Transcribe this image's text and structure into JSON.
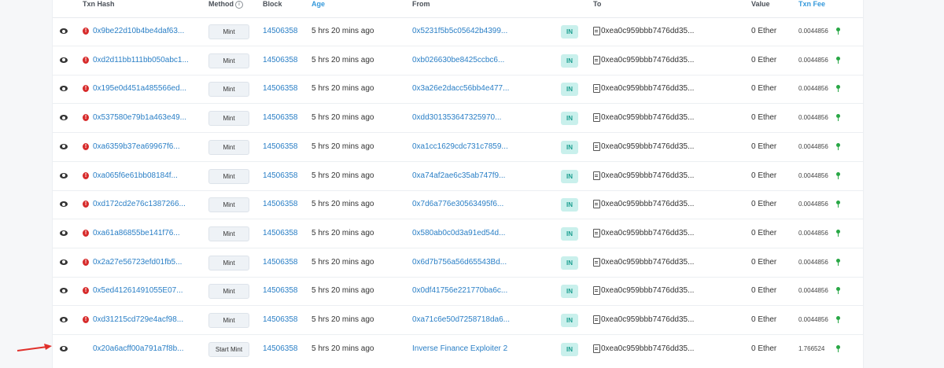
{
  "table": {
    "headers": {
      "txn_hash": "Txn Hash",
      "method": "Method",
      "block": "Block",
      "age": "Age",
      "from": "From",
      "to": "To",
      "value": "Value",
      "txn_fee": "Txn Fee"
    },
    "rows": [
      {
        "hash": "0x9be22d10b4be4daf63...",
        "method": "Mint",
        "block": "14506358",
        "age": "5 hrs 20 mins ago",
        "from": "0x5231f5b5c05642b4399...",
        "direction": "IN",
        "to": "0xea0c959bbb7476dd35...",
        "value": "0 Ether",
        "fee": "0.0044856",
        "error": true
      },
      {
        "hash": "0xd2d11bb111bb050abc1...",
        "method": "Mint",
        "block": "14506358",
        "age": "5 hrs 20 mins ago",
        "from": "0xb026630be8425ccbc6...",
        "direction": "IN",
        "to": "0xea0c959bbb7476dd35...",
        "value": "0 Ether",
        "fee": "0.0044856",
        "error": true
      },
      {
        "hash": "0x195e0d451a485566ed...",
        "method": "Mint",
        "block": "14506358",
        "age": "5 hrs 20 mins ago",
        "from": "0x3a26e2dacc56bb4e477...",
        "direction": "IN",
        "to": "0xea0c959bbb7476dd35...",
        "value": "0 Ether",
        "fee": "0.0044856",
        "error": true
      },
      {
        "hash": "0x537580e79b1a463e49...",
        "method": "Mint",
        "block": "14506358",
        "age": "5 hrs 20 mins ago",
        "from": "0xdd301353647325970...",
        "direction": "IN",
        "to": "0xea0c959bbb7476dd35...",
        "value": "0 Ether",
        "fee": "0.0044856",
        "error": true
      },
      {
        "hash": "0xa6359b37ea69967f6...",
        "method": "Mint",
        "block": "14506358",
        "age": "5 hrs 20 mins ago",
        "from": "0xa1cc1629cdc731c7859...",
        "direction": "IN",
        "to": "0xea0c959bbb7476dd35...",
        "value": "0 Ether",
        "fee": "0.0044856",
        "error": true
      },
      {
        "hash": "0xa065f6e61bb08184f...",
        "method": "Mint",
        "block": "14506358",
        "age": "5 hrs 20 mins ago",
        "from": "0xa74af2ae6c35ab747f9...",
        "direction": "IN",
        "to": "0xea0c959bbb7476dd35...",
        "value": "0 Ether",
        "fee": "0.0044856",
        "error": true
      },
      {
        "hash": "0xd172cd2e76c1387266...",
        "method": "Mint",
        "block": "14506358",
        "age": "5 hrs 20 mins ago",
        "from": "0x7d6a776e30563495f6...",
        "direction": "IN",
        "to": "0xea0c959bbb7476dd35...",
        "value": "0 Ether",
        "fee": "0.0044856",
        "error": true
      },
      {
        "hash": "0xa61a86855be141f76...",
        "method": "Mint",
        "block": "14506358",
        "age": "5 hrs 20 mins ago",
        "from": "0x580ab0c0d3a91ed54d...",
        "direction": "IN",
        "to": "0xea0c959bbb7476dd35...",
        "value": "0 Ether",
        "fee": "0.0044856",
        "error": true
      },
      {
        "hash": "0x2a27e56723efd01fb5...",
        "method": "Mint",
        "block": "14506358",
        "age": "5 hrs 20 mins ago",
        "from": "0x6d7b756a56d65543Bd...",
        "direction": "IN",
        "to": "0xea0c959bbb7476dd35...",
        "value": "0 Ether",
        "fee": "0.0044856",
        "error": true
      },
      {
        "hash": "0x5ed41261491055E07...",
        "method": "Mint",
        "block": "14506358",
        "age": "5 hrs 20 mins ago",
        "from": "0x0df41756e221770ba6c...",
        "direction": "IN",
        "to": "0xea0c959bbb7476dd35...",
        "value": "0 Ether",
        "fee": "0.0044856",
        "error": true
      },
      {
        "hash": "0xd31215cd729e4acf98...",
        "method": "Mint",
        "block": "14506358",
        "age": "5 hrs 20 mins ago",
        "from": "0xa71c6e50d7258718da6...",
        "direction": "IN",
        "to": "0xea0c959bbb7476dd35...",
        "value": "0 Ether",
        "fee": "0.0044856",
        "error": true
      },
      {
        "hash": "0x20a6acff00a791a7f8b...",
        "method": "Start Mint",
        "block": "14506358",
        "age": "5 hrs 20 mins ago",
        "from": "Inverse Finance Exploiter 2",
        "direction": "IN",
        "to": "0xea0c959bbb7476dd35...",
        "value": "0 Ether",
        "fee": "1.766524",
        "error": false
      }
    ]
  },
  "icons": {
    "view": "eye-icon",
    "error": "error-icon",
    "contract": "contract-icon",
    "gas": "gas-icon",
    "pointer": "red-arrow-annotation"
  },
  "colors": {
    "link": "#2a7fc6",
    "error": "#d72b2b",
    "in_badge_bg": "#c9f0ec",
    "in_badge_text": "#1a9d8f",
    "arrow": "#e0302b",
    "gas": "#28a745"
  }
}
